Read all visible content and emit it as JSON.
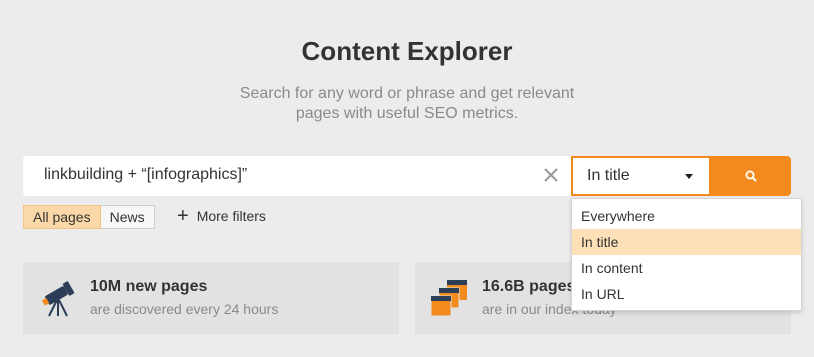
{
  "header": {
    "title": "Content Explorer",
    "subtitle_line1": "Search for any word or phrase and get relevant",
    "subtitle_line2": "pages with useful SEO metrics."
  },
  "search": {
    "value": "linkbuilding + “[infographics]”",
    "mode": "In title",
    "clear_icon": "close-icon",
    "button_icon": "search-icon"
  },
  "filters": {
    "tabs": [
      {
        "label": "All pages",
        "active": true
      },
      {
        "label": "News",
        "active": false
      }
    ],
    "more_label": "More filters"
  },
  "cards": [
    {
      "icon": "telescope-icon",
      "head": "10M new pages",
      "sub": "are discovered every 24 hours"
    },
    {
      "icon": "pages-icon",
      "head": "16.6B pages",
      "sub": "are in our index today"
    }
  ],
  "dropdown": {
    "options": [
      "Everywhere",
      "In title",
      "In content",
      "In URL"
    ],
    "selected": "In title"
  },
  "colors": {
    "accent": "#f28a1e",
    "active_tab": "#fbd8a8",
    "selected_option": "#fde0b8",
    "background": "#ececec"
  }
}
